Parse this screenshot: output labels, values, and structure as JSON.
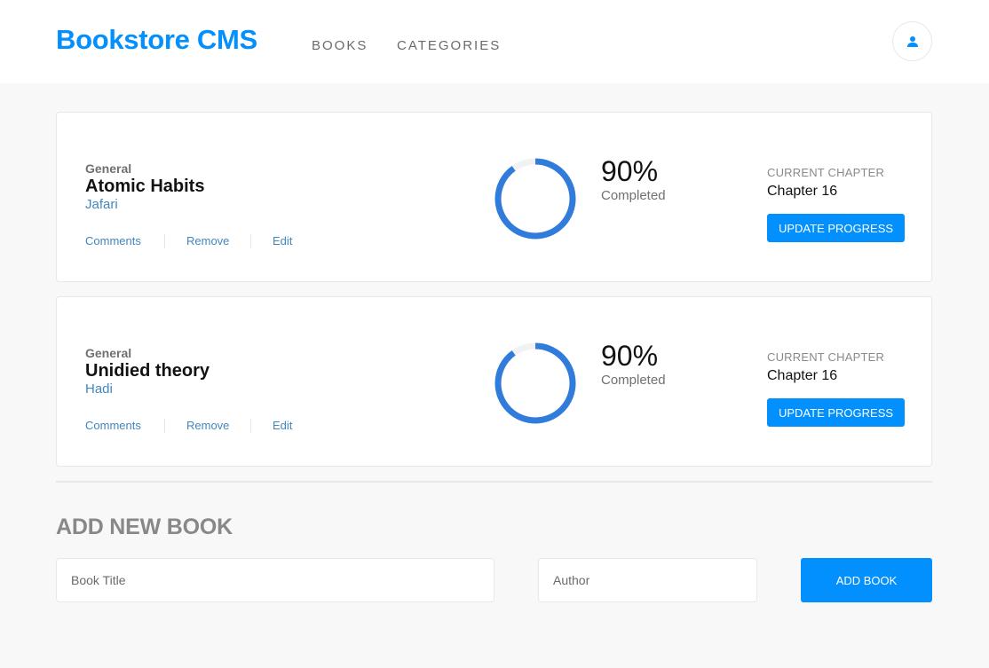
{
  "header": {
    "brand": "Bookstore CMS",
    "nav": {
      "books": "BOOKS",
      "categories": "CATEGORIES"
    },
    "user_icon": "user-icon"
  },
  "books": [
    {
      "genre": "General",
      "title": "Atomic Habits",
      "author": "Jafari",
      "actions": {
        "comments": "Comments",
        "remove": "Remove",
        "edit": "Edit"
      },
      "progress": {
        "percent_text": "90%",
        "percent_value": 90,
        "completed_label": "Completed"
      },
      "chapter": {
        "label": "CURRENT CHAPTER",
        "value": "Chapter 16"
      },
      "update_label": "UPDATE PROGRESS"
    },
    {
      "genre": "General",
      "title": "Unidied theory",
      "author": "Hadi",
      "actions": {
        "comments": "Comments",
        "remove": "Remove",
        "edit": "Edit"
      },
      "progress": {
        "percent_text": "90%",
        "percent_value": 90,
        "completed_label": "Completed"
      },
      "chapter": {
        "label": "CURRENT CHAPTER",
        "value": "Chapter 16"
      },
      "update_label": "UPDATE PROGRESS"
    }
  ],
  "form": {
    "title": "ADD NEW BOOK",
    "book_title_placeholder": "Book Title",
    "author_placeholder": "Author",
    "submit_label": "ADD BOOK"
  },
  "colors": {
    "accent": "#0290ff",
    "progress": "#307bdb",
    "link": "#4386bf"
  }
}
